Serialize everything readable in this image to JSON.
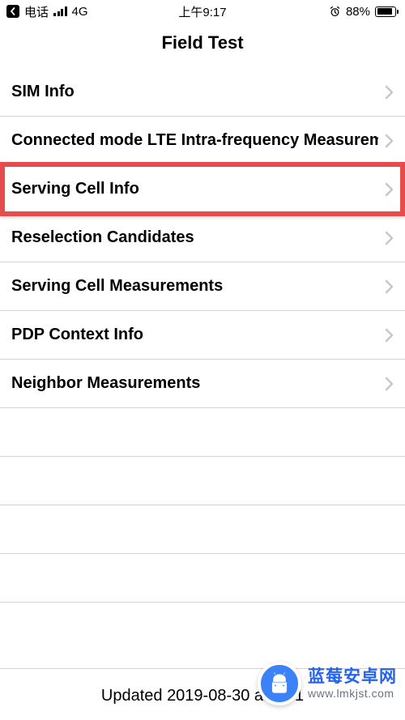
{
  "status": {
    "carrier": "电话",
    "network": "4G",
    "time": "上午9:17",
    "battery_pct": "88%"
  },
  "header": {
    "title": "Field Test"
  },
  "rows": [
    {
      "label": "SIM Info"
    },
    {
      "label": "Connected mode LTE Intra-frequency Measurement"
    },
    {
      "label": "Serving Cell Info",
      "highlighted": true
    },
    {
      "label": "Reselection Candidates"
    },
    {
      "label": "Serving Cell Measurements"
    },
    {
      "label": "PDP Context Info"
    },
    {
      "label": "Neighbor Measurements"
    },
    {
      "label": ""
    },
    {
      "label": ""
    },
    {
      "label": ""
    },
    {
      "label": ""
    }
  ],
  "footer": {
    "text": "Updated 2019-08-30 at 09:1"
  },
  "watermark": {
    "line1": "蓝莓安卓网",
    "line2": "www.lmkjst.com"
  }
}
